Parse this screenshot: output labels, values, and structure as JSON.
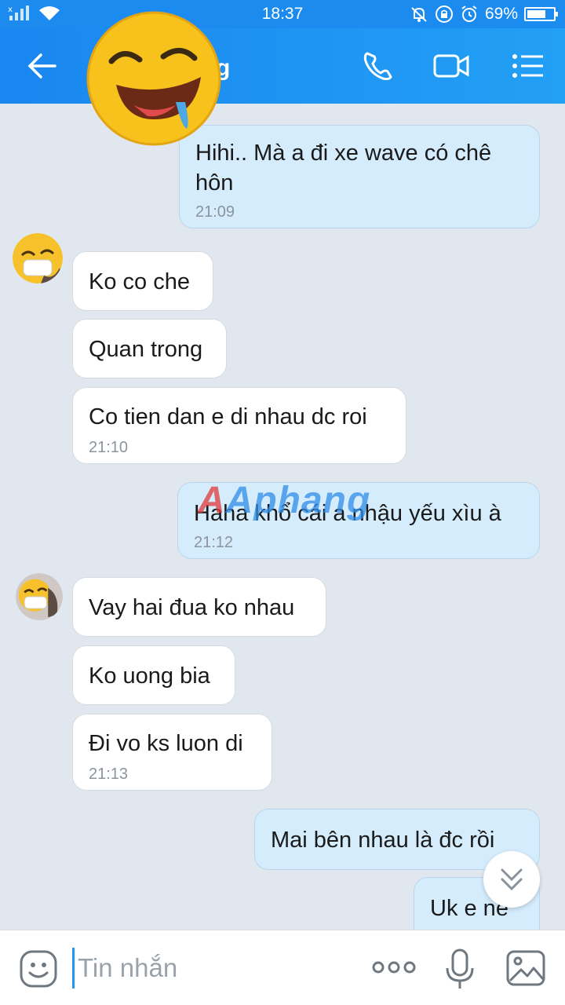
{
  "status_bar": {
    "time": "18:37",
    "battery": "69%",
    "battery_level": 0.69,
    "icons": [
      "signal-icon",
      "wifi-icon",
      "mute-icon",
      "lock-rotation-icon",
      "alarm-icon",
      "battery-icon"
    ]
  },
  "header": {
    "title_visible_fragment": "g",
    "accent_color": "#1a86f0",
    "icons": [
      "back-arrow-icon",
      "phone-icon",
      "video-call-icon",
      "menu-list-icon"
    ]
  },
  "messages": [
    {
      "side": "out",
      "text": "Hihi.. Mà a đi xe wave có chê hôn",
      "time": "21:09"
    },
    {
      "side": "in",
      "text": "Ko co che",
      "time": ""
    },
    {
      "side": "in",
      "text": "Quan trong",
      "time": ""
    },
    {
      "side": "in",
      "text": "Co tien dan e di nhau dc roi",
      "time": "21:10"
    },
    {
      "side": "out",
      "text": "Haha khổ cái a nhậu yếu xìu à",
      "time": "21:12"
    },
    {
      "side": "in",
      "text": "Vay hai đua ko nhau",
      "time": ""
    },
    {
      "side": "in",
      "text": "Ko uong bia",
      "time": ""
    },
    {
      "side": "in",
      "text": "Đi vo ks luon di",
      "time": "21:13"
    },
    {
      "side": "out",
      "text": "Mai bên nhau là đc rồi",
      "time": ""
    },
    {
      "side": "out",
      "text": "Uk e ne",
      "time": ""
    }
  ],
  "watermark": "Aphang",
  "input": {
    "placeholder": "Tin nhắn",
    "icons": [
      "emoji-icon",
      "more-dots-icon",
      "microphone-icon",
      "image-icon"
    ]
  }
}
